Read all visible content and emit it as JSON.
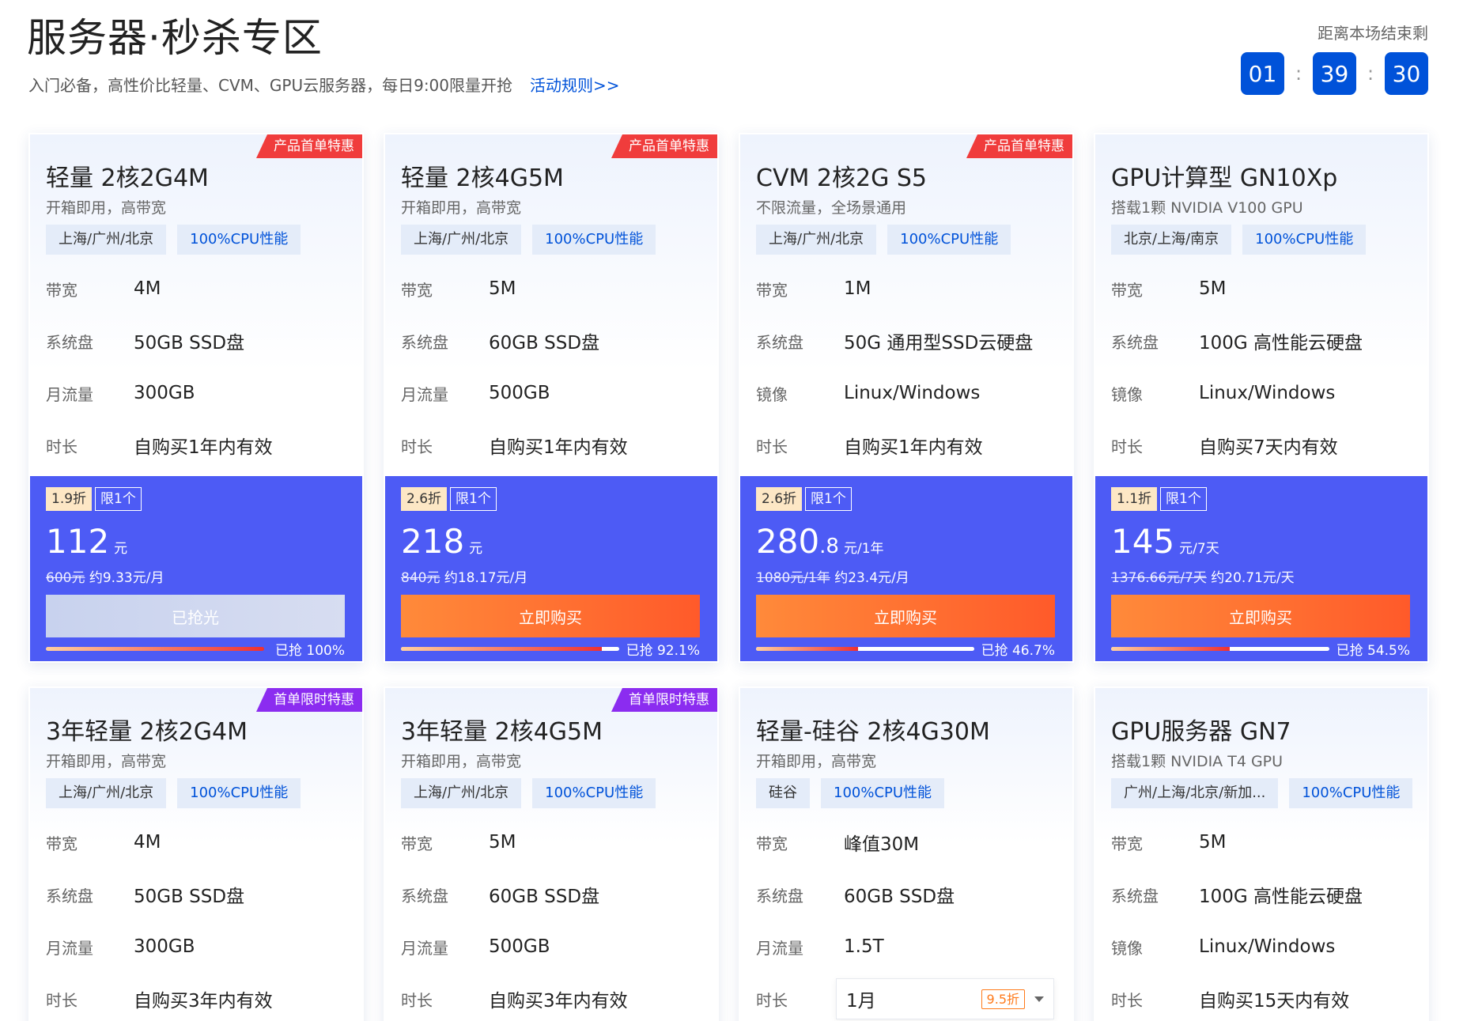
{
  "header": {
    "title": "服务器·秒杀专区",
    "subtitle": "入门必备，高性价比轻量、CVM、GPU云服务器，每日9:00限量开抢",
    "rules_link": "活动规则>>",
    "countdown_label": "距离本场结束剩",
    "countdown": [
      "01",
      "39",
      "30"
    ],
    "countdown_sep": ":"
  },
  "colors": {
    "accent": "#0052d9",
    "price_panel": "#4d5bf5",
    "buy_button": "#ff6a2a",
    "ribbon_red": "#f03c3c",
    "ribbon_purple": "#8b2cf0"
  },
  "cards": [
    {
      "ribbon": "产品首单特惠",
      "title": "轻量 2核2G4M",
      "desc": "开箱即用，高带宽",
      "tags": [
        "上海/广州/北京",
        "100%CPU性能"
      ],
      "specs": [
        {
          "label": "带宽",
          "value": "4M"
        },
        {
          "label": "系统盘",
          "value": "50GB SSD盘"
        },
        {
          "label": "月流量",
          "value": "300GB"
        },
        {
          "label": "时长",
          "value": "自购买1年内有效"
        }
      ],
      "discount": "1.9折",
      "limit": "限1个",
      "price": "112",
      "price_decimal": "",
      "price_unit": "元",
      "original": "600元",
      "per_month": "约9.33元/月",
      "button": "已抢光",
      "sold_out": true,
      "progress": 100,
      "progress_text": "已抢 100%"
    },
    {
      "ribbon": "产品首单特惠",
      "title": "轻量 2核4G5M",
      "desc": "开箱即用，高带宽",
      "tags": [
        "上海/广州/北京",
        "100%CPU性能"
      ],
      "specs": [
        {
          "label": "带宽",
          "value": "5M"
        },
        {
          "label": "系统盘",
          "value": "60GB SSD盘"
        },
        {
          "label": "月流量",
          "value": "500GB"
        },
        {
          "label": "时长",
          "value": "自购买1年内有效"
        }
      ],
      "discount": "2.6折",
      "limit": "限1个",
      "price": "218",
      "price_decimal": "",
      "price_unit": "元",
      "original": "840元",
      "per_month": "约18.17元/月",
      "button": "立即购买",
      "sold_out": false,
      "progress": 92.1,
      "progress_text": "已抢 92.1%"
    },
    {
      "ribbon": "产品首单特惠",
      "title": "CVM 2核2G S5",
      "desc": "不限流量，全场景通用",
      "tags": [
        "上海/广州/北京",
        "100%CPU性能"
      ],
      "specs": [
        {
          "label": "带宽",
          "value": "1M"
        },
        {
          "label": "系统盘",
          "value": "50G 通用型SSD云硬盘"
        },
        {
          "label": "镜像",
          "value": "Linux/Windows"
        },
        {
          "label": "时长",
          "value": "自购买1年内有效"
        }
      ],
      "discount": "2.6折",
      "limit": "限1个",
      "price": "280",
      "price_decimal": ".8",
      "price_unit": "元/1年",
      "original": "1080元/1年",
      "per_month": "约23.4元/月",
      "button": "立即购买",
      "sold_out": false,
      "progress": 46.7,
      "progress_text": "已抢 46.7%"
    },
    {
      "ribbon": "",
      "title": "GPU计算型 GN10Xp",
      "desc": "搭载1颗 NVIDIA V100 GPU",
      "tags": [
        "北京/上海/南京",
        "100%CPU性能"
      ],
      "specs": [
        {
          "label": "带宽",
          "value": "5M"
        },
        {
          "label": "系统盘",
          "value": "100G 高性能云硬盘"
        },
        {
          "label": "镜像",
          "value": "Linux/Windows"
        },
        {
          "label": "时长",
          "value": "自购买7天内有效"
        }
      ],
      "discount": "1.1折",
      "limit": "限1个",
      "price": "145",
      "price_decimal": "",
      "price_unit": "元/7天",
      "original": "1376.66元/7天",
      "per_month": "约20.71元/天",
      "button": "立即购买",
      "sold_out": false,
      "progress": 54.5,
      "progress_text": "已抢 54.5%"
    },
    {
      "ribbon": "首单限时特惠",
      "title": "3年轻量 2核2G4M",
      "desc": "开箱即用，高带宽",
      "tags": [
        "上海/广州/北京",
        "100%CPU性能"
      ],
      "specs": [
        {
          "label": "带宽",
          "value": "4M"
        },
        {
          "label": "系统盘",
          "value": "50GB SSD盘"
        },
        {
          "label": "月流量",
          "value": "300GB"
        },
        {
          "label": "时长",
          "value": "自购买3年内有效"
        }
      ]
    },
    {
      "ribbon": "首单限时特惠",
      "title": "3年轻量 2核4G5M",
      "desc": "开箱即用，高带宽",
      "tags": [
        "上海/广州/北京",
        "100%CPU性能"
      ],
      "specs": [
        {
          "label": "带宽",
          "value": "5M"
        },
        {
          "label": "系统盘",
          "value": "60GB SSD盘"
        },
        {
          "label": "月流量",
          "value": "500GB"
        },
        {
          "label": "时长",
          "value": "自购买3年内有效"
        }
      ]
    },
    {
      "ribbon": "",
      "title": "轻量-硅谷 2核4G30M",
      "desc": "开箱即用，高带宽",
      "tags": [
        "硅谷",
        "100%CPU性能"
      ],
      "specs": [
        {
          "label": "带宽",
          "value": "峰值30M"
        },
        {
          "label": "系统盘",
          "value": "60GB SSD盘"
        },
        {
          "label": "月流量",
          "value": "1.5T"
        }
      ],
      "duration_label": "时长",
      "duration_value": "1月",
      "duration_badge": "9.5折"
    },
    {
      "ribbon": "",
      "title": "GPU服务器 GN7",
      "desc": "搭载1颗 NVIDIA T4 GPU",
      "tags": [
        "广州/上海/北京/新加...",
        "100%CPU性能"
      ],
      "specs": [
        {
          "label": "带宽",
          "value": "5M"
        },
        {
          "label": "系统盘",
          "value": "100G 高性能云硬盘"
        },
        {
          "label": "镜像",
          "value": "Linux/Windows"
        },
        {
          "label": "时长",
          "value": "自购买15天内有效"
        }
      ]
    }
  ]
}
